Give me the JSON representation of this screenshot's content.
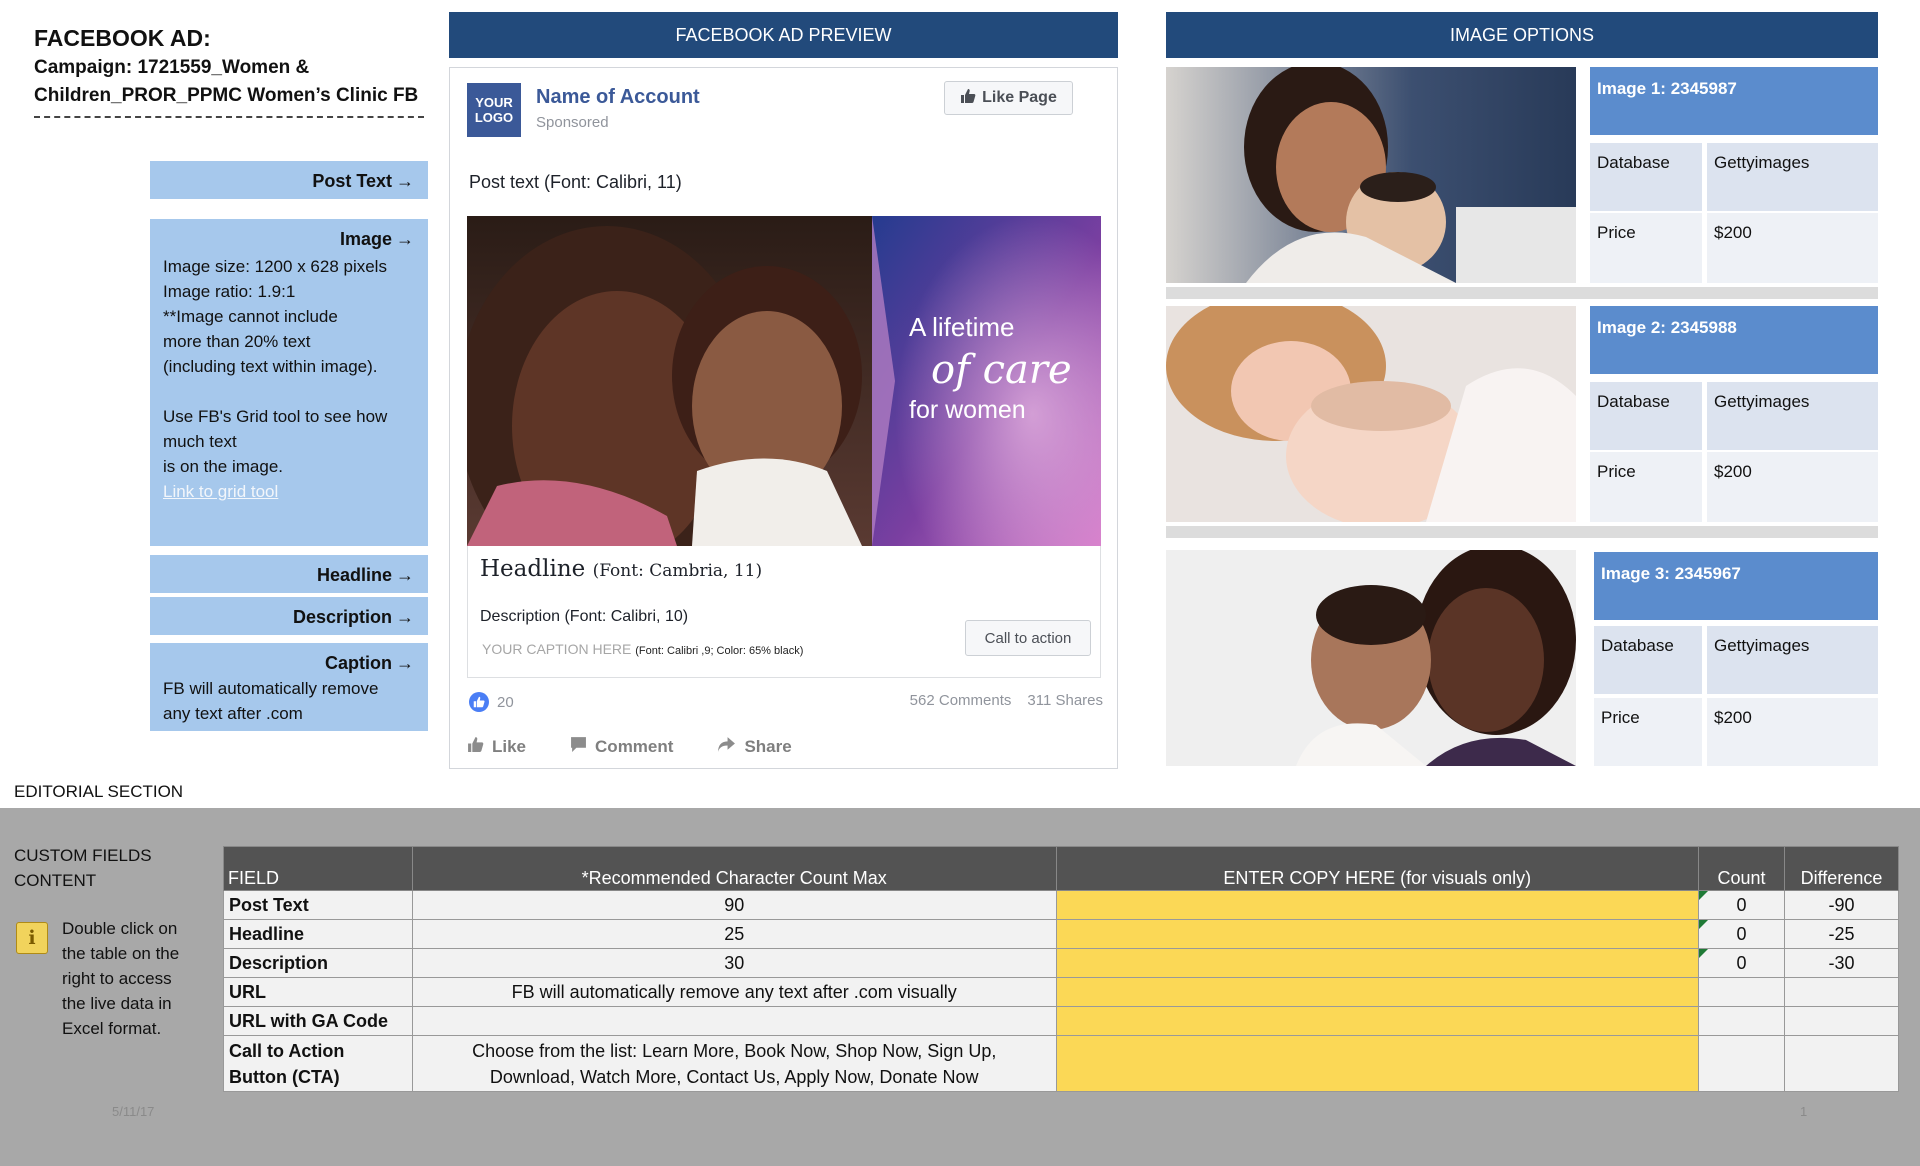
{
  "header": {
    "title": "FACEBOOK AD:",
    "campaign_line1": "Campaign: 1721559_Women &",
    "campaign_line2": "Children_PROR_PPMC Women’s Clinic FB"
  },
  "specs": {
    "post_text": {
      "label": "Post Text"
    },
    "image": {
      "label": "Image",
      "lines": [
        "Image size: 1200 x 628 pixels",
        "Image ratio: 1.9:1",
        "**Image cannot include",
        "more than 20% text",
        "(including text within image).",
        "",
        "Use FB's Grid tool to see how",
        "much text",
        "is on the image."
      ],
      "link": "Link to grid tool"
    },
    "headline": {
      "label": "Headline"
    },
    "description": {
      "label": "Description"
    },
    "caption": {
      "label": "Caption",
      "lines": [
        "FB will automatically remove",
        "any text after .com"
      ]
    },
    "arrow": "→"
  },
  "preview": {
    "header": "FACEBOOK AD PREVIEW",
    "logo_line1": "YOUR",
    "logo_line2": "LOGO",
    "account": "Name of Account",
    "sponsored": "Sponsored",
    "like_page": "Like Page",
    "post_text": "Post text (Font: Calibri, 11)",
    "ad_text_line1": "A lifetime",
    "ad_text_line2": "of care",
    "ad_text_line3": "for women",
    "headline": "Headline",
    "headline_font": "(Font: Cambria, 11)",
    "description": "Description (Font: Calibri, 10)",
    "caption": "YOUR CAPTION HERE",
    "caption_note": "(Font: Calibri ,9; Color: 65% black)",
    "cta": "Call to action",
    "likes": "20",
    "comments": "562 Comments",
    "shares": "311 Shares",
    "actions": [
      "Like",
      "Comment",
      "Share"
    ]
  },
  "image_options": {
    "header": "IMAGE OPTIONS",
    "db_label": "Database",
    "price_label": "Price",
    "items": [
      {
        "title": "Image 1: 2345987",
        "database": "Gettyimages",
        "price": "$200"
      },
      {
        "title": "Image 2: 2345988",
        "database": "Gettyimages",
        "price": "$200"
      },
      {
        "title": "Image 3: 2345967",
        "database": "Gettyimages",
        "price": "$200"
      }
    ]
  },
  "editorial": {
    "section_label": "EDITORIAL SECTION",
    "custom_line1": "CUSTOM FIELDS",
    "custom_line2": "CONTENT",
    "info_lines": [
      "Double click on",
      "the table on the",
      "right to access",
      "the live data in",
      "Excel format."
    ],
    "columns": [
      "FIELD",
      "*Recommended Character Count Max",
      "ENTER COPY HERE (for visuals only)",
      "Count",
      "Difference"
    ],
    "rows": [
      {
        "field": "Post Text",
        "rec": "90",
        "copy": "",
        "count": "0",
        "diff": "-90"
      },
      {
        "field": "Headline",
        "rec": "25",
        "copy": "",
        "count": "0",
        "diff": "-25"
      },
      {
        "field": "Description",
        "rec": "30",
        "copy": "",
        "count": "0",
        "diff": "-30"
      },
      {
        "field": "URL",
        "rec": "FB will automatically remove any text after .com visually",
        "copy": "",
        "count": "",
        "diff": ""
      },
      {
        "field": "URL with GA Code",
        "rec": "",
        "copy": "",
        "count": "",
        "diff": ""
      }
    ],
    "cta_row": {
      "field_line1": "Call to Action",
      "field_line2": "Button (CTA)",
      "rec_line1": "Choose from the list: Learn More, Book Now, Shop Now, Sign Up,",
      "rec_line2": "Download, Watch More, Contact Us, Apply Now, Donate Now"
    }
  },
  "footer": {
    "date": "5/11/17",
    "page": "1"
  },
  "colors": {
    "header_bar": "#224a7b",
    "spec_box": "#a6c8ec",
    "option_head": "#5b8ccd",
    "copy_cell": "#fbd856",
    "fb_blue": "#3b5998"
  }
}
